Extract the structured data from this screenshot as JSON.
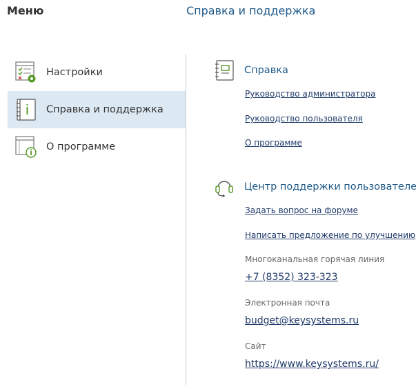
{
  "header": {
    "menu_title": "Меню",
    "page_title": "Справка и поддержка"
  },
  "sidebar": {
    "items": [
      {
        "label": "Настройки",
        "icon": "settings-icon",
        "active": false
      },
      {
        "label": "Справка и поддержка",
        "icon": "help-book-icon",
        "active": true
      },
      {
        "label": "О программе",
        "icon": "about-icon",
        "active": false
      }
    ]
  },
  "help_section": {
    "title": "Справка",
    "icon": "book-icon",
    "links": [
      "Руководство администратора",
      "Руководство пользователя",
      "О программе"
    ]
  },
  "support_section": {
    "title": "Центр поддержки пользователей",
    "icon": "headset-icon",
    "links": [
      "Задать вопрос на форуме",
      "Написать предложение по улучшению"
    ],
    "hotline_label": "Многоканальная горячая линия",
    "hotline_value": "+7 (8352) 323-323",
    "email_label": "Электронная почта",
    "email_value": "budget@keysystems.ru",
    "site_label": "Сайт",
    "site_value": "https://www.keysystems.ru/"
  },
  "colors": {
    "accent": "#1f5a8a",
    "active_bg": "#dce8f2",
    "icon_green": "#5a9a2a"
  }
}
